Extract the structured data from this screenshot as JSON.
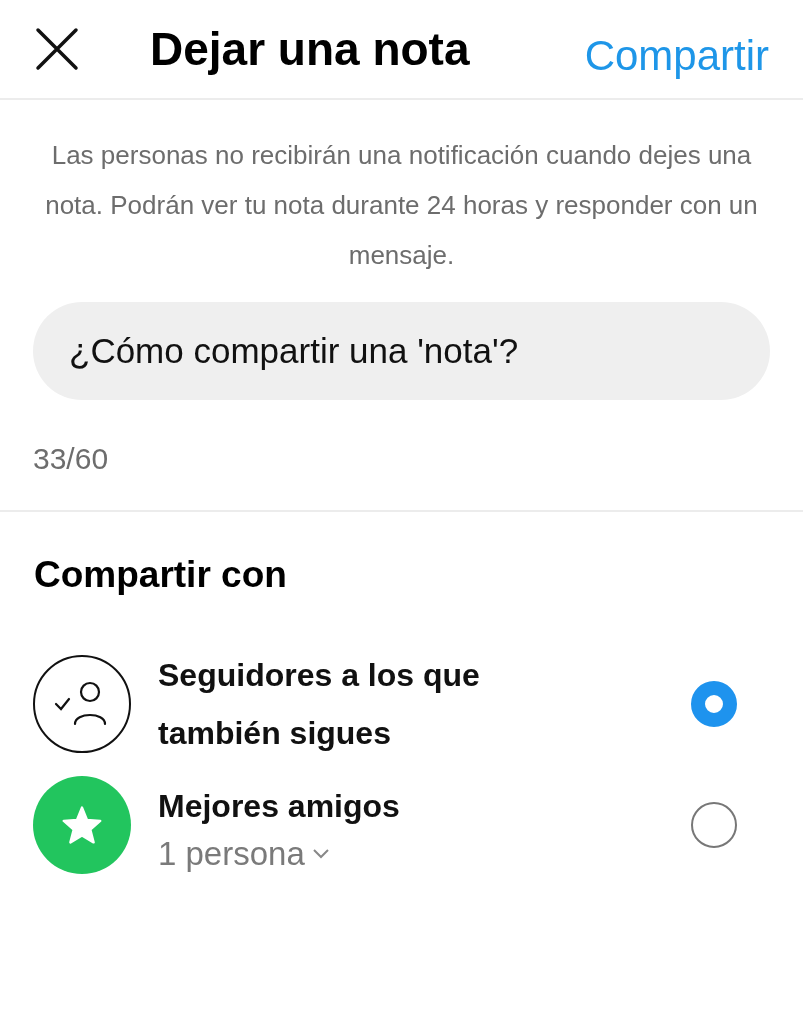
{
  "header": {
    "title": "Dejar una nota",
    "action": "Compartir"
  },
  "notice": "Las personas no recibirán una notificación cuando dejes una nota. Podrán ver tu nota durante 24 horas y responder con un mensaje.",
  "note_field": {
    "value": "¿Cómo compartir una 'nota'?"
  },
  "counter": "33/60",
  "share_heading": "Compartir con",
  "audiences": [
    {
      "kind": "followers",
      "title": "Seguidores a los que también sigues",
      "selected": true
    },
    {
      "kind": "close_friends",
      "title": "Mejores amigos",
      "subtitle": "1 persona",
      "selected": false
    }
  ]
}
